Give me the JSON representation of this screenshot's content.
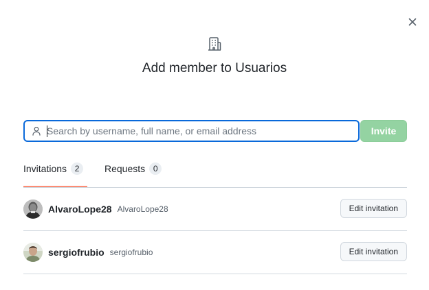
{
  "dialog": {
    "title": "Add member to Usuarios",
    "close_icon": "close-icon",
    "header_icon": "organization-icon"
  },
  "search": {
    "placeholder": "Search by username, full name, or email address",
    "value": "",
    "icon": "person-icon"
  },
  "invite_button": {
    "label": "Invite",
    "enabled": false,
    "color": "#94d3a2"
  },
  "tabs": [
    {
      "label": "Invitations",
      "count": "2",
      "selected": true
    },
    {
      "label": "Requests",
      "count": "0",
      "selected": false
    }
  ],
  "invitations": [
    {
      "name": "AlvaroLope28",
      "login": "AlvaroLope28",
      "action": "Edit invitation"
    },
    {
      "name": "sergiofrubio",
      "login": "sergiofrubio",
      "action": "Edit invitation"
    }
  ],
  "colors": {
    "accent_focus": "#0969da",
    "tab_underline": "#fd8c73",
    "border": "#d0d7de"
  }
}
